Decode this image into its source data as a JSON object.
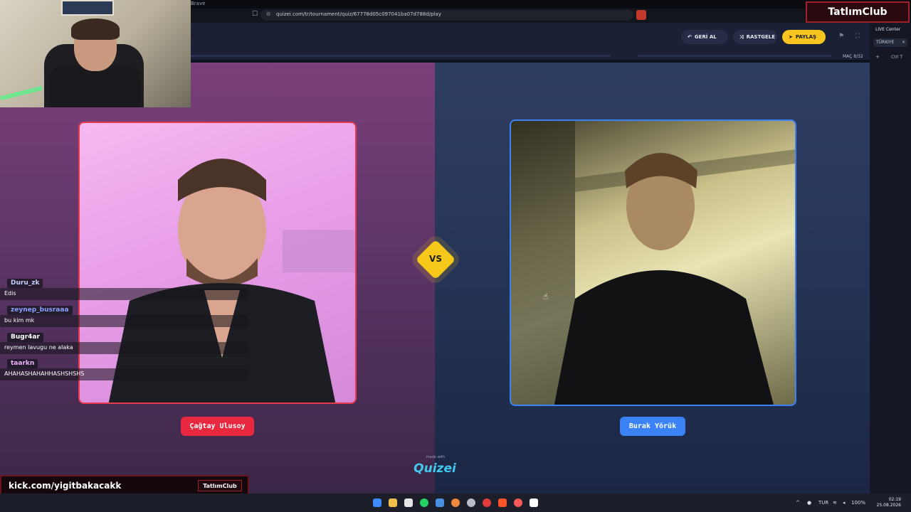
{
  "browser": {
    "app_name": "Brave",
    "url": "quizei.com/tr/tournament/quiz/67778d05c097041ba07d788d/play"
  },
  "header": {
    "undo_label": "GERİ AL",
    "random_label": "RASTGELE",
    "share_label": "PAYLAŞ",
    "round_label": "MAÇ 8/32"
  },
  "sidebar": {
    "live_center": "LIVE Center",
    "tab_label": "TÜRKİYE",
    "close": "×",
    "plus": "+",
    "ctrl": "Ctrl T"
  },
  "overlay": {
    "brand": "TatlımClub",
    "kick_url": "kick.com/yigitbakacakk",
    "kick_badge": "TatlımClub"
  },
  "game": {
    "vs": "VS",
    "left_name": "Çağtay Ulusoy",
    "right_name": "Burak Yörük",
    "made_with": "made with",
    "brand": "Quizei",
    "colors": {
      "left_accent": "#e8283e",
      "right_accent": "#3b82f6",
      "vs": "#f6c81a"
    }
  },
  "chat": [
    {
      "user": "Duru_zk",
      "text": "Edis",
      "color": "#c8d0ff"
    },
    {
      "user": "zeynep_busraaa",
      "text": "bu kim mk",
      "color": "#8aa0ff"
    },
    {
      "user": "Bugr4ar",
      "text": "reymen lavugu ne alaka",
      "color": "#ffffff"
    },
    {
      "user": "taarkn",
      "text": "AHAHASHAHAHHASHSHSHS",
      "color": "#f0b0ff"
    }
  ],
  "taskbar": {
    "lang": "TUR",
    "battery": "100%",
    "time": "02:19",
    "date": "25.08.2026"
  }
}
